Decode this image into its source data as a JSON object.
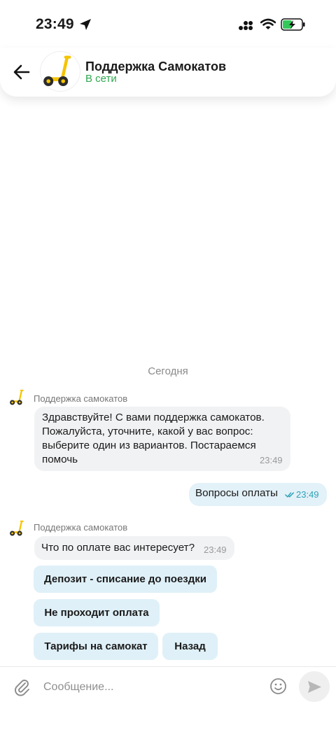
{
  "status_bar": {
    "time": "23:49"
  },
  "header": {
    "title": "Поддержка Самокатов",
    "status": "В сети"
  },
  "chat": {
    "date_separator": "Сегодня",
    "messages": [
      {
        "sender": "Поддержка самокатов",
        "lines": [
          "Здравствуйте! С вами поддержка самокатов.",
          "Пожалуйста, уточните, какой у вас вопрос:",
          "выберите один из вариантов. Постараемся",
          "помочь"
        ],
        "time": "23:49"
      },
      {
        "text": "Вопросы оплаты",
        "time": "23:49",
        "status": "read"
      },
      {
        "sender": "Поддержка самокатов",
        "text": "Что по оплате вас интересует?",
        "time": "23:49"
      }
    ],
    "quick_replies": [
      "Депозит - списание до поездки",
      "Не проходит оплата",
      "Тарифы на самокат",
      "Назад"
    ]
  },
  "composer": {
    "placeholder": "Сообщение..."
  },
  "colors": {
    "online": "#2fa84f",
    "outgoing_bubble": "#e3f1f8",
    "quick_reply": "#dff0f8",
    "incoming_bubble": "#f1f2f4",
    "read_check": "#2ea2b8",
    "scooter_yellow": "#f5c400"
  },
  "icons": [
    "location-arrow-icon",
    "signal-icon",
    "wifi-icon",
    "battery-charging-icon",
    "back-arrow-icon",
    "scooter-icon",
    "attach-clip-icon",
    "emoji-icon",
    "send-icon",
    "double-check-icon"
  ]
}
